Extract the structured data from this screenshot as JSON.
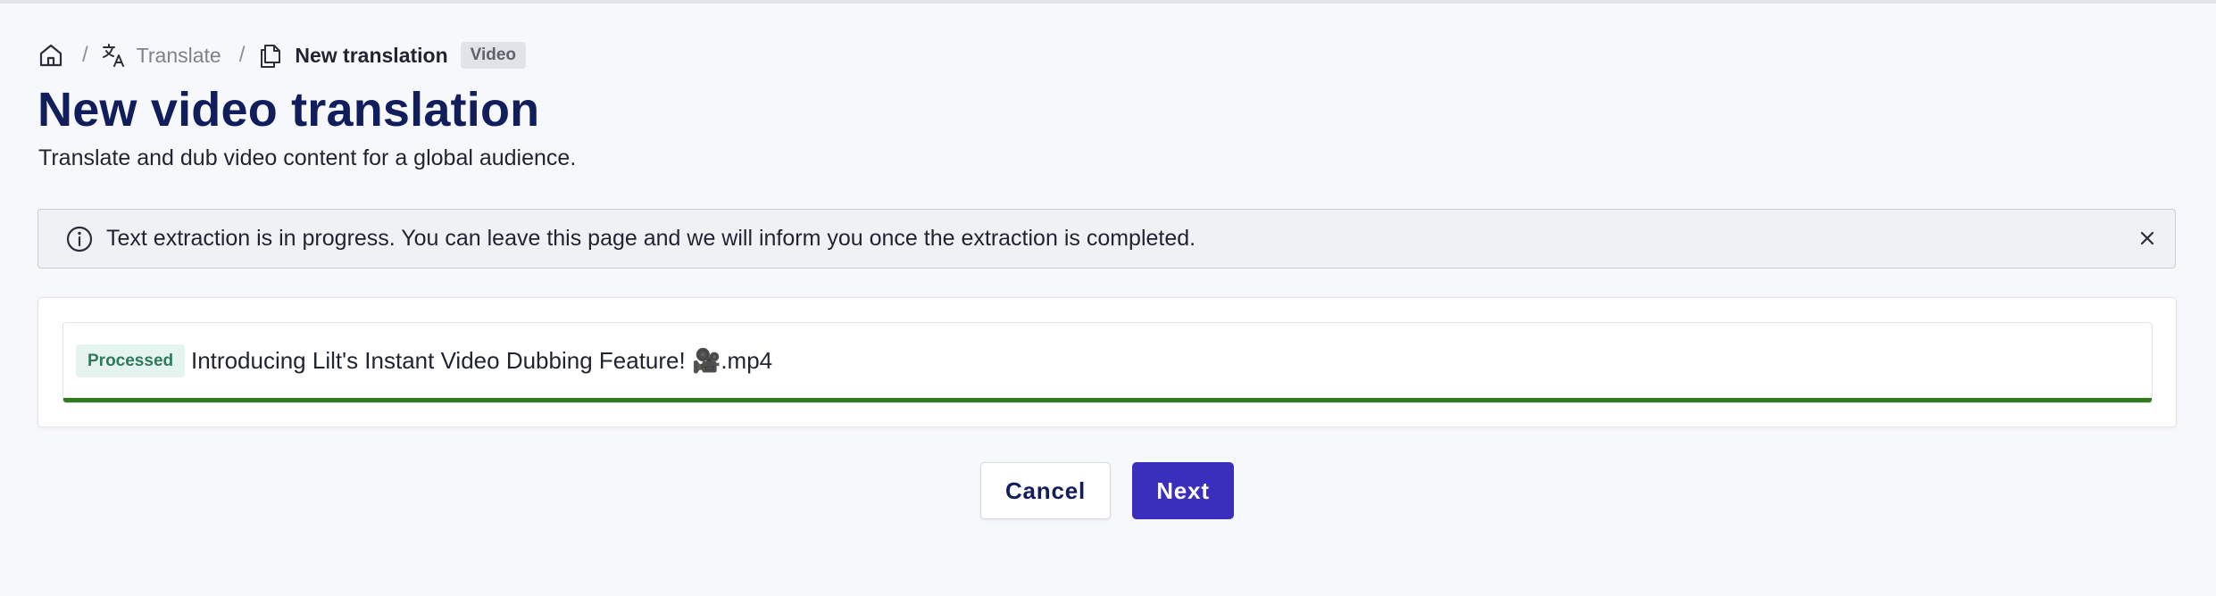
{
  "breadcrumb": {
    "home_icon": "home-icon",
    "translate_icon": "translate-icon",
    "translate_label": "Translate",
    "separator": "/",
    "document_icon": "document-copy-icon",
    "current_label": "New translation",
    "badge": "Video"
  },
  "header": {
    "title": "New video translation",
    "subtitle": "Translate and dub video content for a global audience."
  },
  "alert": {
    "icon": "info-icon",
    "text": "Text extraction is in progress. You can leave this page and we will inform you once the extraction is completed.",
    "close_icon": "close-icon"
  },
  "file": {
    "status": "Processed",
    "name": "Introducing Lilt's Instant Video Dubbing Feature! 🎥.mp4",
    "progress_percent": 100
  },
  "actions": {
    "cancel_label": "Cancel",
    "next_label": "Next"
  },
  "colors": {
    "title": "#121d5b",
    "primary": "#3a2ebc",
    "progress": "#2f7d1f",
    "status_bg": "#e6f4ef",
    "status_text": "#2f7a5a"
  }
}
